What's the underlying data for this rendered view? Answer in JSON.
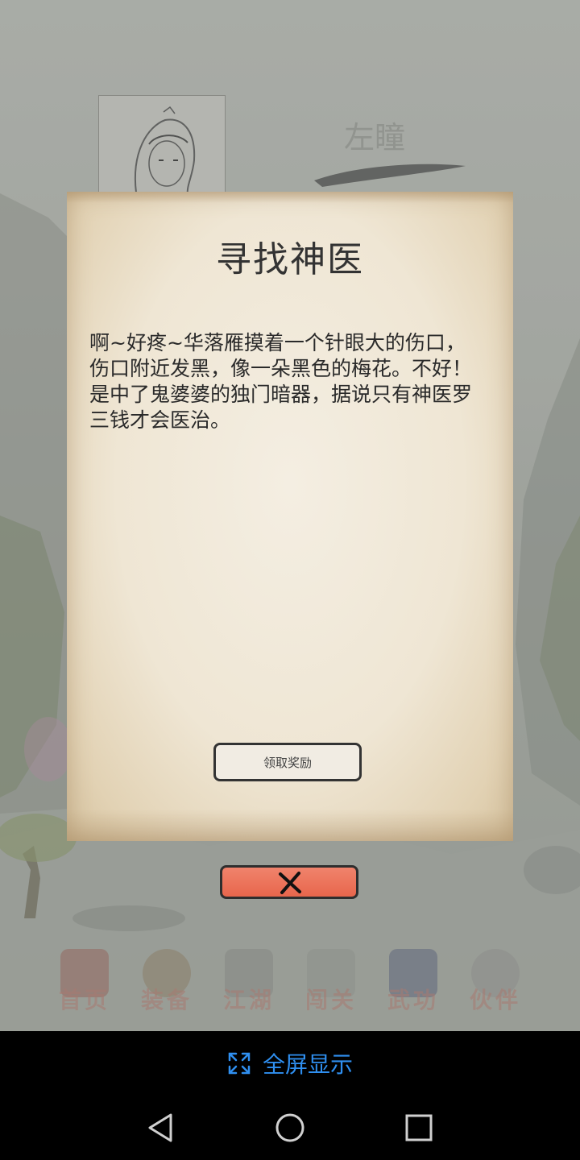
{
  "game": {
    "hero_name": "左瞳",
    "nav": [
      {
        "label": "首页",
        "icon": "home-icon"
      },
      {
        "label": "装备",
        "icon": "armor-icon"
      },
      {
        "label": "江湖",
        "icon": "jianghu-icon"
      },
      {
        "label": "闯关",
        "icon": "crossed-swords-icon"
      },
      {
        "label": "武功",
        "icon": "scroll-book-icon"
      },
      {
        "label": "伙伴",
        "icon": "partners-icon"
      }
    ]
  },
  "dialog": {
    "title": "寻找神医",
    "body": "啊~好疼~华落雁摸着一个针眼大的伤口，伤口附近发黑，像一朵黑色的梅花。不好！是中了鬼婆婆的独门暗器，据说只有神医罗三钱才会医治。",
    "claim_label": "领取奖励",
    "close_icon": "close-x-icon"
  },
  "fullscreen": {
    "label": "全屏显示",
    "icon": "expand-icon",
    "color": "#2f8ff0"
  },
  "system_nav": {
    "back_icon": "back-triangle-icon",
    "home_icon": "home-circle-icon",
    "recents_icon": "recents-square-icon"
  }
}
